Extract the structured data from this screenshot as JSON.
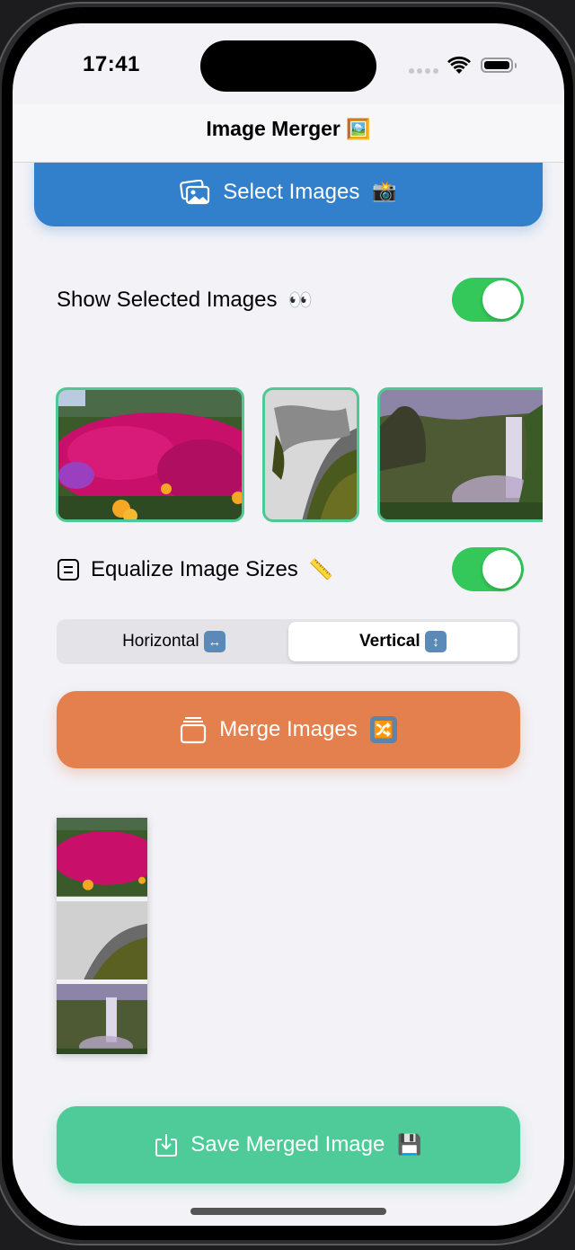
{
  "status_bar": {
    "time": "17:41"
  },
  "nav": {
    "title": "Image Merger",
    "title_emoji": "🖼️"
  },
  "select_button": {
    "label": "Select Images",
    "emoji": "📸",
    "icon": "photo-stack-icon",
    "color": "#3280cc"
  },
  "show_selected": {
    "label": "Show Selected Images",
    "emoji": "👀",
    "enabled": true
  },
  "selected_images": [
    {
      "name": "flowers",
      "description": "Magenta and yellow flowers with green bush"
    },
    {
      "name": "waterfall-closeup",
      "description": "Long-exposure water over mossy rocks"
    },
    {
      "name": "waterfall-landscape",
      "description": "Waterfall in green valley with misty purple sky"
    }
  ],
  "equalize": {
    "label": "Equalize Image Sizes",
    "emoji": "📏",
    "icon": "equal-square-icon",
    "enabled": true
  },
  "orientation": {
    "options": [
      {
        "label": "Horizontal",
        "emoji": "↔"
      },
      {
        "label": "Vertical",
        "emoji": "↕"
      }
    ],
    "selected": "Vertical"
  },
  "merge_button": {
    "label": "Merge Images",
    "emoji": "🔀",
    "icon": "stack-icon",
    "color": "#e4804e"
  },
  "save_button": {
    "label": "Save Merged Image",
    "emoji": "💾",
    "icon": "download-icon",
    "color": "#4ecb98"
  },
  "accent_colors": {
    "toggle_on": "#34c759",
    "thumb_border": "#50c896",
    "background": "#f2f2f7"
  }
}
